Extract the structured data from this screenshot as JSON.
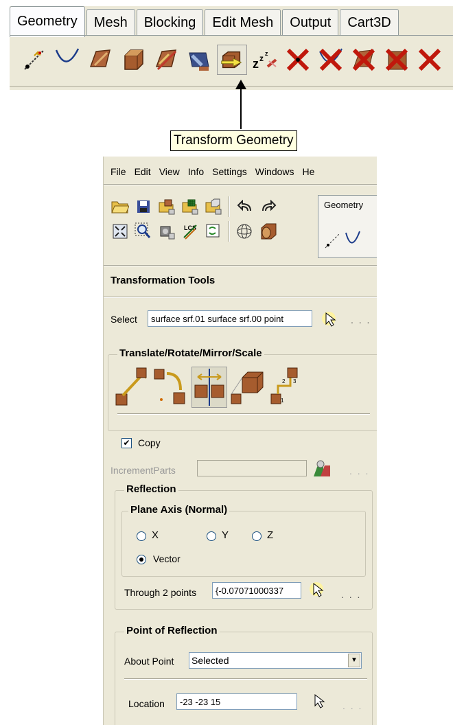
{
  "top_tabs": [
    {
      "label": "Geometry",
      "active": true
    },
    {
      "label": "Mesh"
    },
    {
      "label": "Blocking"
    },
    {
      "label": "Edit Mesh"
    },
    {
      "label": "Output"
    },
    {
      "label": "Cart3D"
    }
  ],
  "geometry_icons": [
    "create-point-icon",
    "create-curve-icon",
    "create-surface-icon",
    "create-body-icon",
    "repair-geometry-icon",
    "faceted-geometry-icon",
    "transform-geometry-icon",
    "restore-dormant-icon",
    "delete-point-icon",
    "delete-curve-icon",
    "delete-surface-icon",
    "delete-body-icon",
    "delete-any-icon"
  ],
  "tooltip": "Transform Geometry",
  "menu": [
    "File",
    "Edit",
    "View",
    "Info",
    "Settings",
    "Windows",
    "He"
  ],
  "mini_tab_label": "Geometry",
  "panel_title": "Transformation Tools",
  "select": {
    "label": "Select",
    "value": "surface srf.01 surface srf.00 point",
    "dots": ". . ."
  },
  "trms_group": {
    "legend": "Translate/Rotate/Mirror/Scale"
  },
  "copy": {
    "label": "Copy",
    "checked": true
  },
  "increment_parts": {
    "label": "IncrementParts",
    "value": "",
    "dots": ". . ."
  },
  "reflection": {
    "legend": "Reflection",
    "plane_axis": {
      "legend": "Plane Axis (Normal)",
      "options": [
        {
          "label": "X",
          "selected": false
        },
        {
          "label": "Y",
          "selected": false
        },
        {
          "label": "Z",
          "selected": false
        },
        {
          "label": "Vector",
          "selected": true
        }
      ]
    },
    "through": {
      "label": "Through 2 points",
      "value": "{-0.07071000337",
      "dots": ". . ."
    }
  },
  "point_reflection": {
    "legend": "Point of Reflection",
    "about_label": "About Point",
    "about_value": "Selected",
    "location_label": "Location",
    "location_value": "-23 -23 15",
    "dots": ". . ."
  }
}
